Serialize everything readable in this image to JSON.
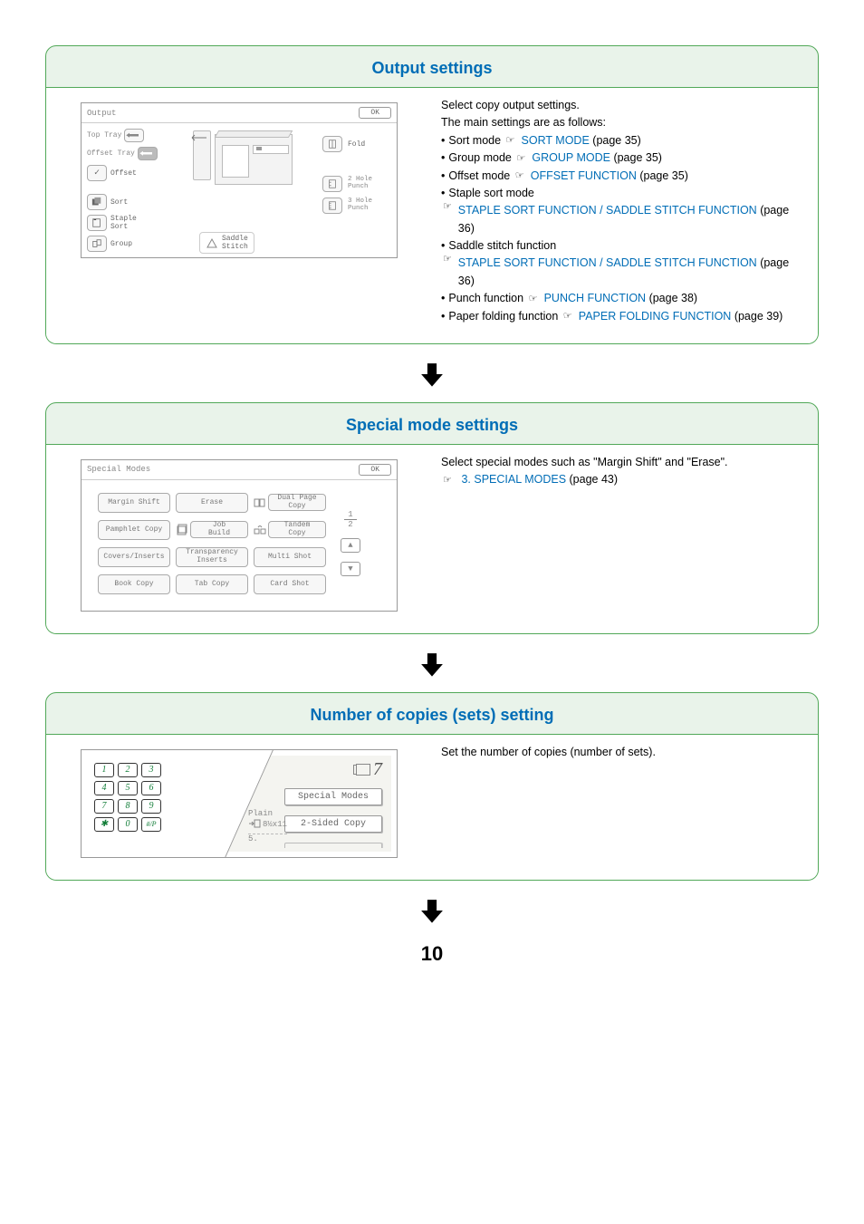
{
  "page_number": "10",
  "sections": {
    "output": {
      "title": "Output settings",
      "dialog": {
        "title": "Output",
        "ok": "OK",
        "top_tray": "Top Tray",
        "offset_tray": "Offset Tray",
        "offset": "Offset",
        "sort": "Sort",
        "staple_sort": "Staple\nSort",
        "group": "Group",
        "saddle_stitch": "Saddle\nStitch",
        "fold": "Fold",
        "punch2": "2 Hole\nPunch",
        "punch3": "3 Hole\nPunch"
      },
      "desc": {
        "intro1": "Select copy output settings.",
        "intro2": "The main settings are as follows:",
        "items": [
          {
            "label": "Sort mode",
            "link": "SORT MODE",
            "page": "(page 35)"
          },
          {
            "label": "Group mode",
            "link": "GROUP MODE",
            "page": "(page 35)"
          },
          {
            "label": "Offset mode",
            "link": "OFFSET FUNCTION",
            "page": "(page 35)"
          },
          {
            "label": "Staple sort mode",
            "link": "STAPLE SORT FUNCTION / SADDLE STITCH FUNCTION",
            "page": "(page 36)"
          },
          {
            "label": "Saddle stitch function",
            "link": "STAPLE SORT FUNCTION / SADDLE STITCH FUNCTION",
            "page": "(page 36)"
          },
          {
            "label": "Punch function",
            "link": "PUNCH FUNCTION",
            "page": "(page 38)"
          },
          {
            "label": "Paper folding function",
            "link": "PAPER FOLDING FUNCTION",
            "page": "(page 39)"
          }
        ]
      }
    },
    "special": {
      "title": "Special mode settings",
      "dialog": {
        "title": "Special Modes",
        "ok": "OK",
        "page_indicator": {
          "top": "1",
          "bottom": "2"
        },
        "buttons": [
          "Margin Shift",
          "Erase",
          "Dual Page\nCopy",
          "Pamphlet Copy",
          "Job\nBuild",
          "Tandem\nCopy",
          "Covers/Inserts",
          "Transparency\nInserts",
          "Multi Shot",
          "Book Copy",
          "Tab Copy",
          "Card Shot"
        ]
      },
      "desc": {
        "line1": "Select special modes such as \"Margin Shift\" and \"Erase\".",
        "link": "3. SPECIAL MODES",
        "page": "(page 43)"
      }
    },
    "copies": {
      "title": "Number of copies (sets) setting",
      "dialog": {
        "keypad": [
          "1",
          "2",
          "3",
          "4",
          "5",
          "6",
          "7",
          "8",
          "9",
          "✱",
          "0",
          "#/P"
        ],
        "display_count": "7",
        "special_modes": "Special Modes",
        "two_sided": "2-Sided Copy",
        "paper_type": "Plain",
        "paper_size": "8½x11",
        "tray_num": "5."
      },
      "desc": {
        "line1": "Set the number of copies (number of sets)."
      }
    }
  }
}
